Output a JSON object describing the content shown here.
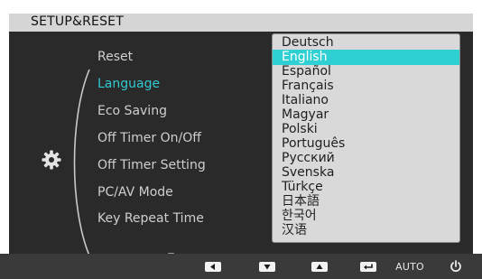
{
  "osd": {
    "title": "SETUP&RESET",
    "menu": {
      "items": [
        {
          "label": "Reset",
          "selected": false,
          "has_colon": false
        },
        {
          "label": "Language",
          "selected": true,
          "has_colon": true
        },
        {
          "label": "Eco Saving",
          "selected": false,
          "has_colon": true
        },
        {
          "label": "Off Timer On/Off",
          "selected": false,
          "has_colon": true
        },
        {
          "label": "Off Timer Setting",
          "selected": false,
          "has_colon": false
        },
        {
          "label": "PC/AV Mode",
          "selected": false,
          "has_colon": false
        },
        {
          "label": "Key Repeat Time",
          "selected": false,
          "has_colon": true
        }
      ],
      "more_indicator": "▼",
      "colon": ":"
    },
    "language_dropdown": {
      "options": [
        "Deutsch",
        "English",
        "Español",
        "Français",
        "Italiano",
        "Magyar",
        "Polski",
        "Português",
        "Русский",
        "Svenska",
        "Türkçe",
        "日本語",
        "한국어",
        "汉语"
      ],
      "selected": "English"
    },
    "button_bar": {
      "buttons": [
        {
          "name": "left",
          "icon": "left-arrow-key-icon"
        },
        {
          "name": "down",
          "icon": "down-arrow-key-icon"
        },
        {
          "name": "up",
          "icon": "up-arrow-key-icon"
        },
        {
          "name": "enter",
          "icon": "enter-key-icon"
        }
      ],
      "auto_label": "AUTO",
      "power_icon": "power-icon"
    },
    "colors": {
      "highlight": "#2fd0d4",
      "selected_text": "#31c9d0",
      "panel": "#2a2a2a",
      "titlebar": "#d5d5d5"
    }
  }
}
